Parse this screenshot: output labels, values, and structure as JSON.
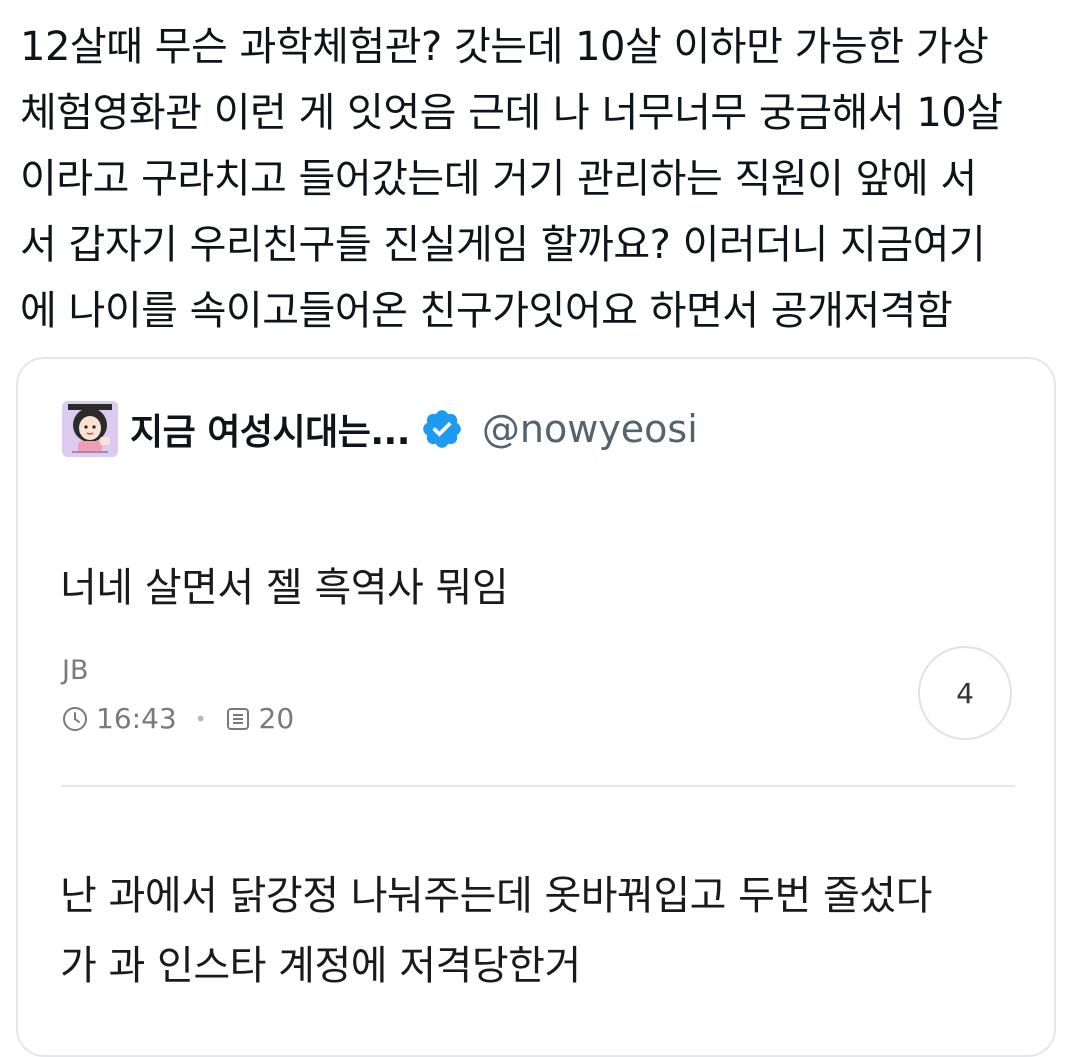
{
  "tweet": {
    "lines": [
      "12살때 무슨 과학체험관? 갓는데 10살 이하만 가능한 가상",
      "체험영화관 이런 게 잇엇음 근데 나 너무너무 궁금해서 10살",
      "이라고 구라치고 들어갔는데 거기 관리하는 직원이 앞에 서",
      "서 갑자기 우리친구들 진실게임 할까요? 이러더니 지금여기",
      "에 나이를 속이고들어온 친구가잇어요 하면서 공개저격함"
    ]
  },
  "quote": {
    "display_name": "지금 여성시대는...",
    "handle": "@nowyeosi",
    "avatar_icon": "cartoon-girl-avatar",
    "verified_icon": "verified-badge-icon",
    "verified_color": "#1d9bf0",
    "post": {
      "title": "너네 살면서 젤 흑역사 뭐임",
      "author": "JB",
      "time": "16:43",
      "views": "20",
      "comment_count": "4"
    },
    "comment": {
      "lines": [
        "난 과에서 닭강정 나눠주는데 옷바꿔입고 두번 줄섰다",
        "가 과 인스타 계정에 저격당한거"
      ]
    }
  }
}
